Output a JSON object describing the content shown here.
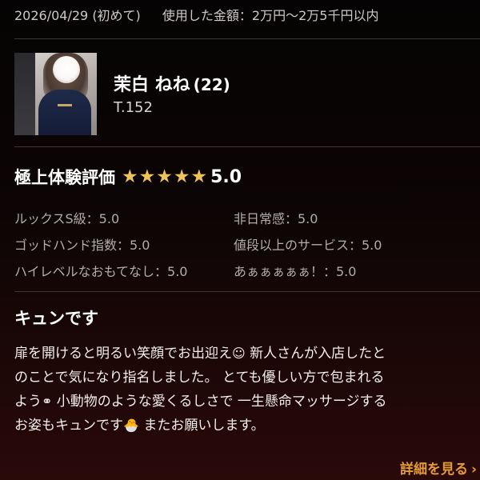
{
  "visit": {
    "date": "2026/04/29",
    "visit_type": "(初めて)",
    "spent_label": "使用した金額：",
    "spent_value": "2万円〜2万5千円以内"
  },
  "profile": {
    "name": "茉白 ねね",
    "age": "(22)",
    "height": "T.152"
  },
  "rating": {
    "title": "極上体験評価",
    "score": "5.0",
    "stars": 5,
    "star_color": "#f0c35a",
    "star_icon": "star-icon"
  },
  "criteria": [
    {
      "left": "ルックスS級：5.0",
      "right": "非日常感：5.0"
    },
    {
      "left": "ゴッドハンド指数：5.0",
      "right": "値段以上のサービス：5.0"
    },
    {
      "left": "ハイレベルなおもてなし：5.0",
      "right": "あぁぁぁぁぁ！：5.0"
    }
  ],
  "review": {
    "title": "キュンです",
    "lines": [
      {
        "text": "扉を開けると明るい笑顔でお出迎え",
        "emoji": "☺",
        "text2": " 新人さんが入店したと"
      },
      {
        "text": "のことで気になり指名しました。 とても優しい方で包まれる",
        "emoji": "",
        "text2": ""
      },
      {
        "text": "よう",
        "emoji": "⚭",
        "text2": " 小動物のような愛くるしさで 一生懸命マッサージする"
      },
      {
        "text": "お姿もキュンです",
        "emoji": "🐣",
        "text2": " またお願いします。"
      }
    ]
  },
  "more_link": {
    "label": "詳細を見る",
    "chevron": "›",
    "color": "#e39a3b"
  }
}
